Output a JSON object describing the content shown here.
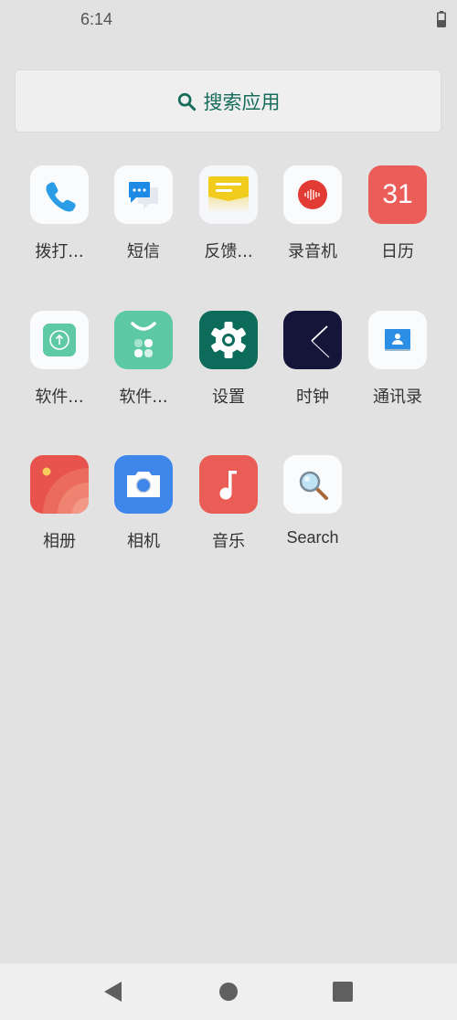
{
  "status_bar": {
    "time": "6:14",
    "battery_icon": "battery-icon"
  },
  "search": {
    "label": "搜索应用",
    "icon": "search-icon"
  },
  "apps": [
    {
      "label": "拨打...",
      "icon": "phone-icon"
    },
    {
      "label": "短信",
      "icon": "message-icon"
    },
    {
      "label": "反馈...",
      "icon": "feedback-icon"
    },
    {
      "label": "录音机",
      "icon": "recorder-icon"
    },
    {
      "label": "日历",
      "icon": "calendar-icon",
      "icon_text": "31"
    },
    {
      "label": "软件...",
      "icon": "update-icon"
    },
    {
      "label": "软件...",
      "icon": "app-store-icon"
    },
    {
      "label": "设置",
      "icon": "gear-icon"
    },
    {
      "label": "时钟",
      "icon": "clock-icon"
    },
    {
      "label": "通讯录",
      "icon": "contacts-icon"
    },
    {
      "label": "相册",
      "icon": "gallery-icon"
    },
    {
      "label": "相机",
      "icon": "camera-icon"
    },
    {
      "label": "音乐",
      "icon": "music-icon"
    },
    {
      "label": "Search",
      "icon": "magnifier-icon"
    }
  ],
  "navbar": {
    "back": "back-icon",
    "home": "home-icon",
    "recents": "recents-icon"
  },
  "colors": {
    "accent": "#166c5a",
    "background": "#e2e2e2"
  }
}
